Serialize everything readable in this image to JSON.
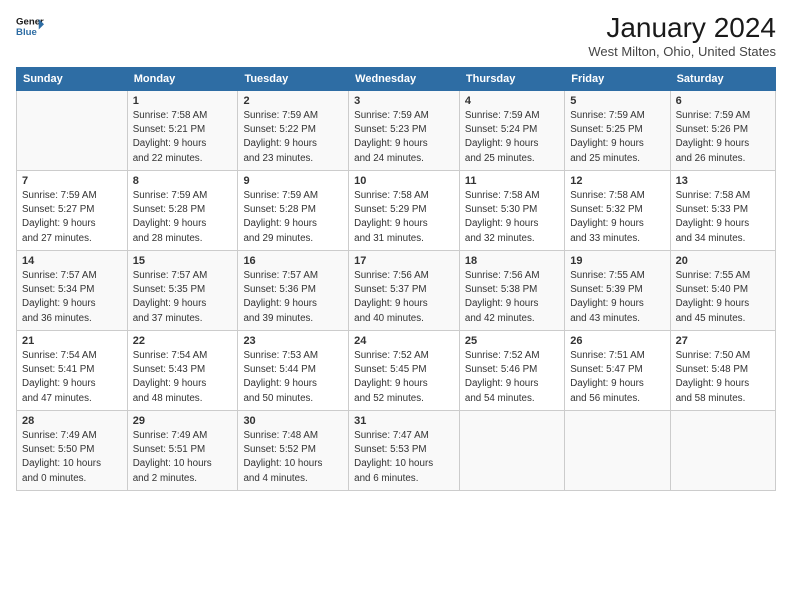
{
  "logo": {
    "line1": "General",
    "line2": "Blue"
  },
  "title": "January 2024",
  "location": "West Milton, Ohio, United States",
  "days_of_week": [
    "Sunday",
    "Monday",
    "Tuesday",
    "Wednesday",
    "Thursday",
    "Friday",
    "Saturday"
  ],
  "weeks": [
    [
      {
        "day": "",
        "info": ""
      },
      {
        "day": "1",
        "info": "Sunrise: 7:58 AM\nSunset: 5:21 PM\nDaylight: 9 hours\nand 22 minutes."
      },
      {
        "day": "2",
        "info": "Sunrise: 7:59 AM\nSunset: 5:22 PM\nDaylight: 9 hours\nand 23 minutes."
      },
      {
        "day": "3",
        "info": "Sunrise: 7:59 AM\nSunset: 5:23 PM\nDaylight: 9 hours\nand 24 minutes."
      },
      {
        "day": "4",
        "info": "Sunrise: 7:59 AM\nSunset: 5:24 PM\nDaylight: 9 hours\nand 25 minutes."
      },
      {
        "day": "5",
        "info": "Sunrise: 7:59 AM\nSunset: 5:25 PM\nDaylight: 9 hours\nand 25 minutes."
      },
      {
        "day": "6",
        "info": "Sunrise: 7:59 AM\nSunset: 5:26 PM\nDaylight: 9 hours\nand 26 minutes."
      }
    ],
    [
      {
        "day": "7",
        "info": "Sunrise: 7:59 AM\nSunset: 5:27 PM\nDaylight: 9 hours\nand 27 minutes."
      },
      {
        "day": "8",
        "info": "Sunrise: 7:59 AM\nSunset: 5:28 PM\nDaylight: 9 hours\nand 28 minutes."
      },
      {
        "day": "9",
        "info": "Sunrise: 7:59 AM\nSunset: 5:28 PM\nDaylight: 9 hours\nand 29 minutes."
      },
      {
        "day": "10",
        "info": "Sunrise: 7:58 AM\nSunset: 5:29 PM\nDaylight: 9 hours\nand 31 minutes."
      },
      {
        "day": "11",
        "info": "Sunrise: 7:58 AM\nSunset: 5:30 PM\nDaylight: 9 hours\nand 32 minutes."
      },
      {
        "day": "12",
        "info": "Sunrise: 7:58 AM\nSunset: 5:32 PM\nDaylight: 9 hours\nand 33 minutes."
      },
      {
        "day": "13",
        "info": "Sunrise: 7:58 AM\nSunset: 5:33 PM\nDaylight: 9 hours\nand 34 minutes."
      }
    ],
    [
      {
        "day": "14",
        "info": "Sunrise: 7:57 AM\nSunset: 5:34 PM\nDaylight: 9 hours\nand 36 minutes."
      },
      {
        "day": "15",
        "info": "Sunrise: 7:57 AM\nSunset: 5:35 PM\nDaylight: 9 hours\nand 37 minutes."
      },
      {
        "day": "16",
        "info": "Sunrise: 7:57 AM\nSunset: 5:36 PM\nDaylight: 9 hours\nand 39 minutes."
      },
      {
        "day": "17",
        "info": "Sunrise: 7:56 AM\nSunset: 5:37 PM\nDaylight: 9 hours\nand 40 minutes."
      },
      {
        "day": "18",
        "info": "Sunrise: 7:56 AM\nSunset: 5:38 PM\nDaylight: 9 hours\nand 42 minutes."
      },
      {
        "day": "19",
        "info": "Sunrise: 7:55 AM\nSunset: 5:39 PM\nDaylight: 9 hours\nand 43 minutes."
      },
      {
        "day": "20",
        "info": "Sunrise: 7:55 AM\nSunset: 5:40 PM\nDaylight: 9 hours\nand 45 minutes."
      }
    ],
    [
      {
        "day": "21",
        "info": "Sunrise: 7:54 AM\nSunset: 5:41 PM\nDaylight: 9 hours\nand 47 minutes."
      },
      {
        "day": "22",
        "info": "Sunrise: 7:54 AM\nSunset: 5:43 PM\nDaylight: 9 hours\nand 48 minutes."
      },
      {
        "day": "23",
        "info": "Sunrise: 7:53 AM\nSunset: 5:44 PM\nDaylight: 9 hours\nand 50 minutes."
      },
      {
        "day": "24",
        "info": "Sunrise: 7:52 AM\nSunset: 5:45 PM\nDaylight: 9 hours\nand 52 minutes."
      },
      {
        "day": "25",
        "info": "Sunrise: 7:52 AM\nSunset: 5:46 PM\nDaylight: 9 hours\nand 54 minutes."
      },
      {
        "day": "26",
        "info": "Sunrise: 7:51 AM\nSunset: 5:47 PM\nDaylight: 9 hours\nand 56 minutes."
      },
      {
        "day": "27",
        "info": "Sunrise: 7:50 AM\nSunset: 5:48 PM\nDaylight: 9 hours\nand 58 minutes."
      }
    ],
    [
      {
        "day": "28",
        "info": "Sunrise: 7:49 AM\nSunset: 5:50 PM\nDaylight: 10 hours\nand 0 minutes."
      },
      {
        "day": "29",
        "info": "Sunrise: 7:49 AM\nSunset: 5:51 PM\nDaylight: 10 hours\nand 2 minutes."
      },
      {
        "day": "30",
        "info": "Sunrise: 7:48 AM\nSunset: 5:52 PM\nDaylight: 10 hours\nand 4 minutes."
      },
      {
        "day": "31",
        "info": "Sunrise: 7:47 AM\nSunset: 5:53 PM\nDaylight: 10 hours\nand 6 minutes."
      },
      {
        "day": "",
        "info": ""
      },
      {
        "day": "",
        "info": ""
      },
      {
        "day": "",
        "info": ""
      }
    ]
  ]
}
